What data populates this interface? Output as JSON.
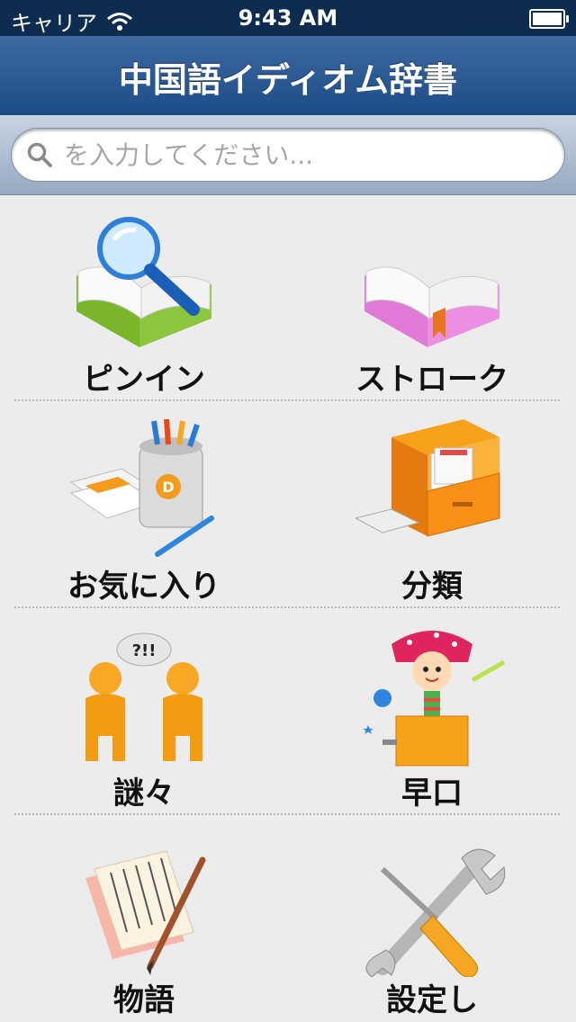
{
  "status_bar": {
    "carrier": "キャリア",
    "time": "9:43 AM"
  },
  "nav": {
    "title": "中国語イディオム辞書"
  },
  "search": {
    "placeholder": "を入力してください..."
  },
  "menu": [
    {
      "label": "ピンイン",
      "icon": "magnifier-book-icon"
    },
    {
      "label": "ストローク",
      "icon": "open-book-icon"
    },
    {
      "label": "お気に入り",
      "icon": "pencil-cup-icon"
    },
    {
      "label": "分類",
      "icon": "file-drawer-icon"
    },
    {
      "label": "謎々",
      "icon": "question-people-icon"
    },
    {
      "label": "早口",
      "icon": "jack-in-box-icon"
    },
    {
      "label": "物語",
      "icon": "scroll-brush-icon"
    },
    {
      "label": "設定し",
      "icon": "wrench-screwdriver-icon"
    }
  ]
}
